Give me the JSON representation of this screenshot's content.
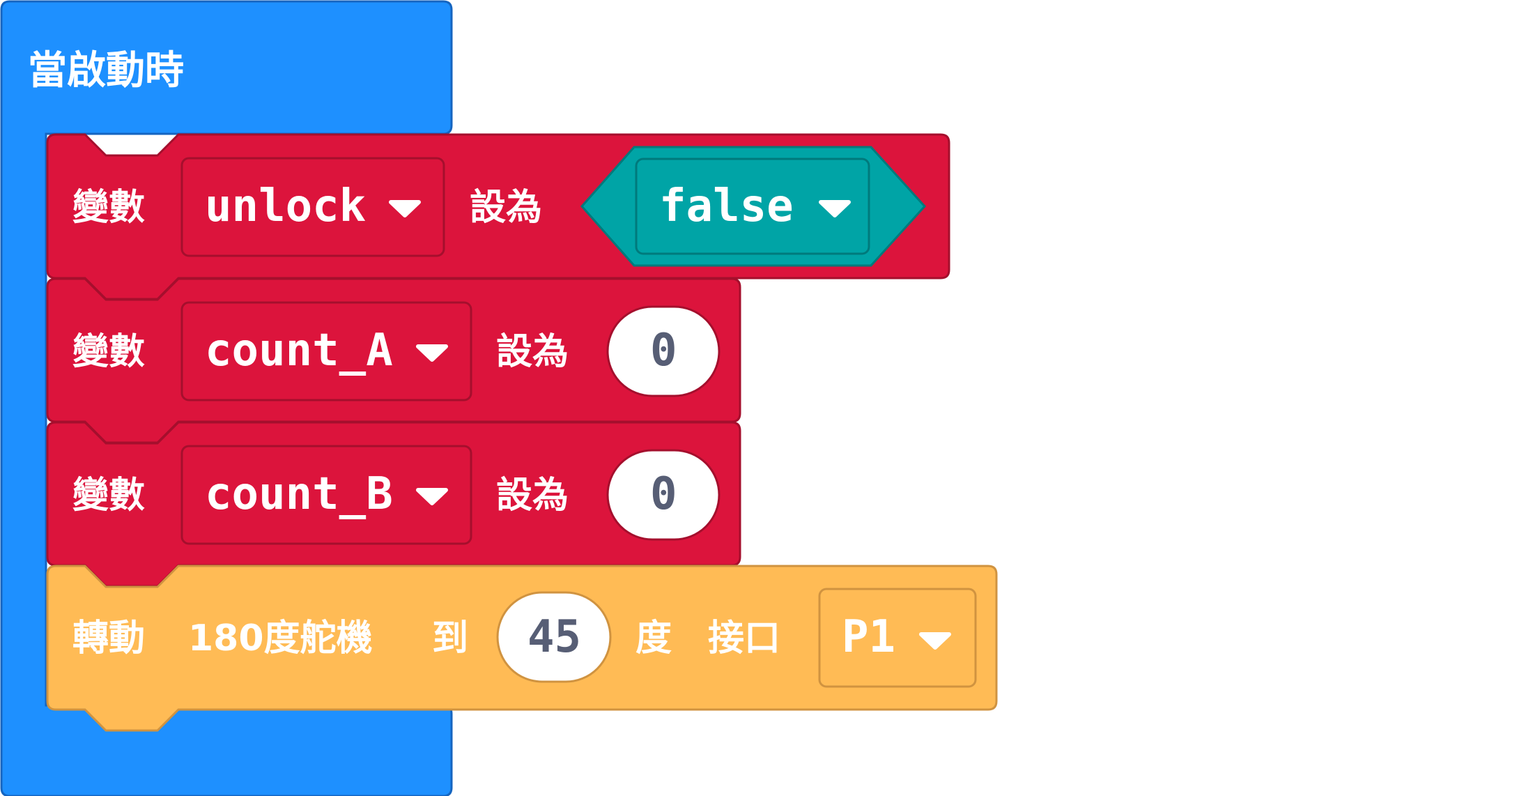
{
  "colors": {
    "event_block": "#1e90ff",
    "variables_block": "#dc143c",
    "logic_block": "#00a4a6",
    "servo_block": "#ffbb55",
    "number_text": "#575e75"
  },
  "event": {
    "label": "當啟動時"
  },
  "statements": [
    {
      "prefix": "變數",
      "variable": "unlock",
      "set_label": "設為",
      "value": "false",
      "value_type": "boolean-dropdown"
    },
    {
      "prefix": "變數",
      "variable": "count_A",
      "set_label": "設為",
      "value": "0",
      "value_type": "number"
    },
    {
      "prefix": "變數",
      "variable": "count_B",
      "set_label": "設為",
      "value": "0",
      "value_type": "number"
    }
  ],
  "servo": {
    "label_rotate": "轉動",
    "label_servo": "180度舵機",
    "label_to": "到",
    "angle": "45",
    "label_degree": "度",
    "label_pin": "接口",
    "pin": "P1"
  },
  "icons": {
    "dropdown": "triangle-down-icon"
  }
}
